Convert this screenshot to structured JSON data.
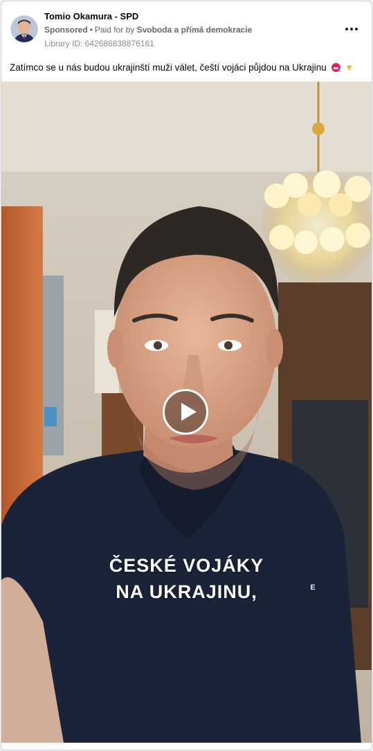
{
  "post": {
    "author": "Tomio Okamura - SPD",
    "sponsored": "Sponsored",
    "separator": "•",
    "paid_for_prefix": "Paid for by",
    "paid_for_by": "Svoboda a přímá demokracie",
    "library_id": "Library ID: 642686838876161",
    "caption": "Zatímco se u nás budou ukrajinští muži válet, čeští vojáci půjdou na Ukrajinu",
    "caption_emojis": [
      "angry-face-icon",
      "thumbs-down-icon"
    ]
  },
  "video": {
    "subtitle_line1": "ČESKÉ VOJÁKY",
    "subtitle_line2": "NA UKRAJINU,",
    "shirt_badge": "E"
  },
  "colors": {
    "card_bg": "#ffffff",
    "text_primary": "#050505",
    "text_secondary": "#65676b",
    "shirt": "#1b2338"
  }
}
